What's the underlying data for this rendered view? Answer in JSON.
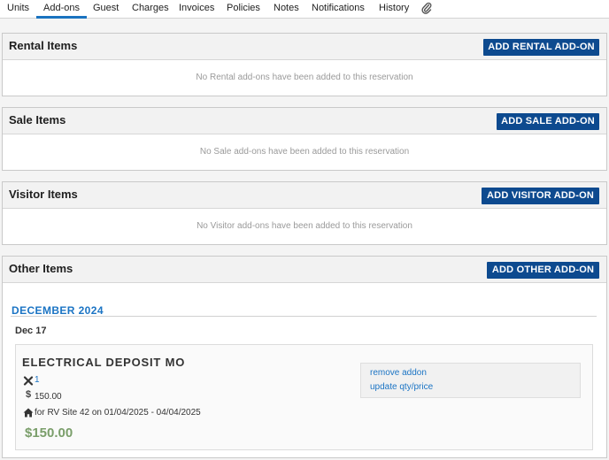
{
  "tabs": [
    "Units",
    "Add-ons",
    "Guest",
    "Charges",
    "Invoices",
    "Policies",
    "Notes",
    "Notifications",
    "History"
  ],
  "active_tab": "Add-ons",
  "attachment_icon": "paperclip-icon",
  "sections": {
    "rental": {
      "title": "Rental Items",
      "button": "ADD RENTAL ADD-ON",
      "empty": "No Rental add-ons have been added to this reservation"
    },
    "sale": {
      "title": "Sale Items",
      "button": "ADD SALE ADD-ON",
      "empty": "No Sale add-ons have been added to this reservation"
    },
    "visitor": {
      "title": "Visitor Items",
      "button": "ADD VISITOR ADD-ON",
      "empty": "No Visitor add-ons have been added to this reservation"
    },
    "other": {
      "title": "Other Items",
      "button": "ADD OTHER ADD-ON",
      "month": "DECEMBER 2024",
      "day": "Dec 17",
      "addon": {
        "name": "ELECTRICAL DEPOSIT MO",
        "qty_icon": "times-icon",
        "qty": "1",
        "price_icon": "dollar-icon",
        "price": "150.00",
        "site_icon": "home-icon",
        "site": "for RV Site 42 on 01/04/2025 - 04/04/2025",
        "total": "$150.00",
        "remove": "remove addon",
        "update": "update qty/price"
      }
    }
  },
  "colors": {
    "button": "#0d4a8f",
    "link": "#1b74c4",
    "total": "#7a9e6a"
  }
}
